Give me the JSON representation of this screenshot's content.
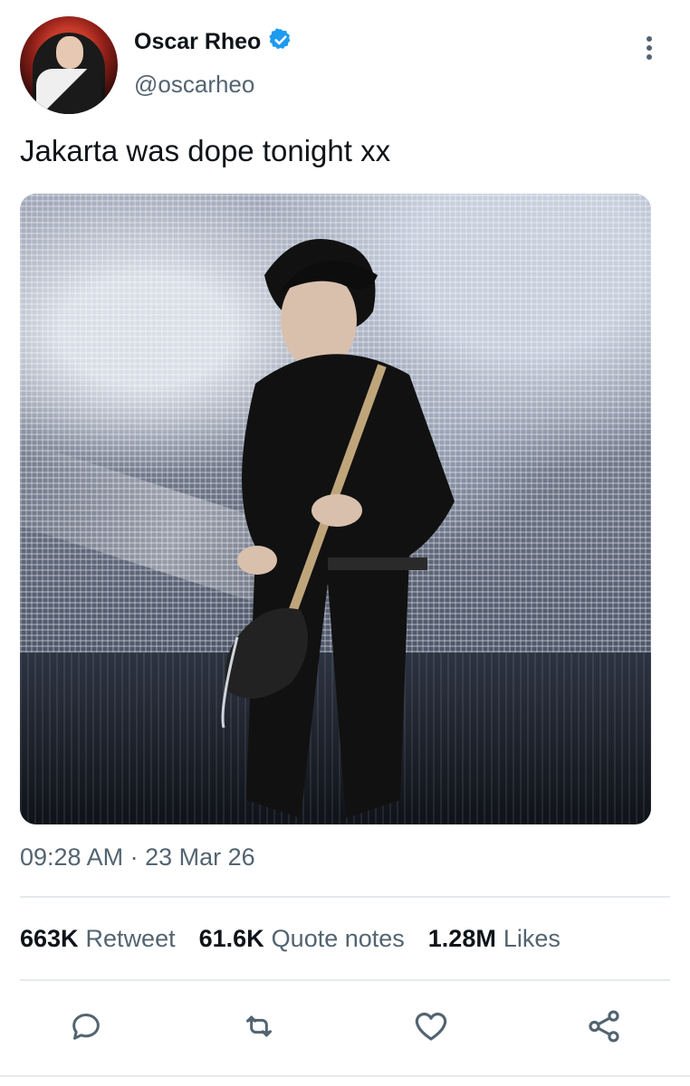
{
  "tweet": {
    "author_name": "Oscar Rheo",
    "author_handle": "@oscarheo",
    "text": "Jakarta was dope tonight xx",
    "timestamp": "09:28 AM · 23 Mar 26"
  },
  "stats": [
    {
      "value": "663K",
      "label": "Retweet"
    },
    {
      "value": "61.6K",
      "label": "Quote notes"
    },
    {
      "value": "1.28M",
      "label": "Likes"
    }
  ],
  "actions": [
    {
      "icon": "reply-icon"
    },
    {
      "icon": "retweet-icon"
    },
    {
      "icon": "like-icon"
    },
    {
      "icon": "share-icon"
    }
  ],
  "colors": {
    "verified": "#1d9bf0",
    "secondary_text": "#536471",
    "primary_text": "#0f1419",
    "icon_gray": "#536471"
  }
}
